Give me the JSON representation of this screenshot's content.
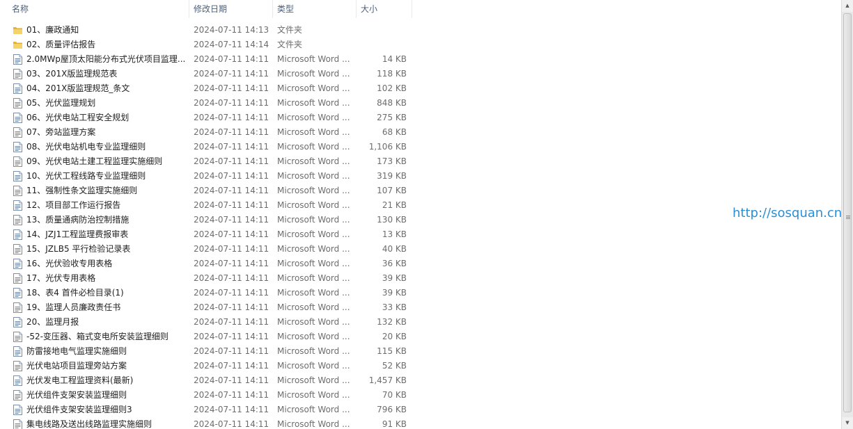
{
  "columns": {
    "name": "名称",
    "date": "修改日期",
    "type": "类型",
    "size": "大小"
  },
  "sort_indicator": "˄",
  "watermark": "http://sosquan.cn",
  "rows": [
    {
      "name": "01、廉政通知",
      "date": "2024-07-11 14:13",
      "type": "文件夹",
      "size": "",
      "icon": "folder"
    },
    {
      "name": "02、质量评估报告",
      "date": "2024-07-11 14:14",
      "type": "文件夹",
      "size": "",
      "icon": "folder"
    },
    {
      "name": "2.0MWp屋顶太阳能分布式光伏项目监理...",
      "date": "2024-07-11 14:11",
      "type": "Microsoft Word ...",
      "size": "14 KB",
      "icon": "doc"
    },
    {
      "name": "03、201X版监理规范表",
      "date": "2024-07-11 14:11",
      "type": "Microsoft Word ...",
      "size": "118 KB",
      "icon": "doc"
    },
    {
      "name": "04、201X版监理规范_条文",
      "date": "2024-07-11 14:11",
      "type": "Microsoft Word ...",
      "size": "102 KB",
      "icon": "doc"
    },
    {
      "name": "05、光伏监理规划",
      "date": "2024-07-11 14:11",
      "type": "Microsoft Word ...",
      "size": "848 KB",
      "icon": "doc"
    },
    {
      "name": "06、光伏电站工程安全规划",
      "date": "2024-07-11 14:11",
      "type": "Microsoft Word ...",
      "size": "275 KB",
      "icon": "doc"
    },
    {
      "name": "07、旁站监理方案",
      "date": "2024-07-11 14:11",
      "type": "Microsoft Word ...",
      "size": "68 KB",
      "icon": "doc"
    },
    {
      "name": "08、光伏电站机电专业监理细则",
      "date": "2024-07-11 14:11",
      "type": "Microsoft Word ...",
      "size": "1,106 KB",
      "icon": "doc"
    },
    {
      "name": "09、光伏电站土建工程监理实施细则",
      "date": "2024-07-11 14:11",
      "type": "Microsoft Word ...",
      "size": "173 KB",
      "icon": "doc"
    },
    {
      "name": "10、光伏工程线路专业监理细则",
      "date": "2024-07-11 14:11",
      "type": "Microsoft Word ...",
      "size": "319 KB",
      "icon": "doc"
    },
    {
      "name": "11、强制性条文监理实施细则",
      "date": "2024-07-11 14:11",
      "type": "Microsoft Word ...",
      "size": "107 KB",
      "icon": "doc"
    },
    {
      "name": "12、项目部工作运行报告",
      "date": "2024-07-11 14:11",
      "type": "Microsoft Word ...",
      "size": "21 KB",
      "icon": "doc"
    },
    {
      "name": "13、质量通病防治控制措施",
      "date": "2024-07-11 14:11",
      "type": "Microsoft Word ...",
      "size": "130 KB",
      "icon": "doc"
    },
    {
      "name": "14、JZJ1工程监理费报审表",
      "date": "2024-07-11 14:11",
      "type": "Microsoft Word ...",
      "size": "13 KB",
      "icon": "doc"
    },
    {
      "name": "15、JZLB5 平行检验记录表",
      "date": "2024-07-11 14:11",
      "type": "Microsoft Word ...",
      "size": "40 KB",
      "icon": "doc"
    },
    {
      "name": "16、光伏验收专用表格",
      "date": "2024-07-11 14:11",
      "type": "Microsoft Word ...",
      "size": "36 KB",
      "icon": "doc"
    },
    {
      "name": "17、光伏专用表格",
      "date": "2024-07-11 14:11",
      "type": "Microsoft Word ...",
      "size": "39 KB",
      "icon": "doc"
    },
    {
      "name": "18、表4 首件必检目录(1)",
      "date": "2024-07-11 14:11",
      "type": "Microsoft Word ...",
      "size": "39 KB",
      "icon": "doc"
    },
    {
      "name": "19、监理人员廉政责任书",
      "date": "2024-07-11 14:11",
      "type": "Microsoft Word ...",
      "size": "33 KB",
      "icon": "doc"
    },
    {
      "name": "20、监理月报",
      "date": "2024-07-11 14:11",
      "type": "Microsoft Word ...",
      "size": "132 KB",
      "icon": "doc"
    },
    {
      "name": "-52-变压器、箱式变电所安装监理细则",
      "date": "2024-07-11 14:11",
      "type": "Microsoft Word ...",
      "size": "20 KB",
      "icon": "doc"
    },
    {
      "name": "防雷接地电气监理实施细则",
      "date": "2024-07-11 14:11",
      "type": "Microsoft Word ...",
      "size": "115 KB",
      "icon": "doc"
    },
    {
      "name": "光伏电站项目监理旁站方案",
      "date": "2024-07-11 14:11",
      "type": "Microsoft Word ...",
      "size": "52 KB",
      "icon": "doc"
    },
    {
      "name": "光伏发电工程监理资料(最新)",
      "date": "2024-07-11 14:11",
      "type": "Microsoft Word ...",
      "size": "1,457 KB",
      "icon": "doc"
    },
    {
      "name": "光伏组件支架安装监理细则",
      "date": "2024-07-11 14:11",
      "type": "Microsoft Word ...",
      "size": "70 KB",
      "icon": "doc"
    },
    {
      "name": "光伏组件支架安装监理细则3",
      "date": "2024-07-11 14:11",
      "type": "Microsoft Word ...",
      "size": "796 KB",
      "icon": "doc"
    },
    {
      "name": "集电线路及送出线路监理实施细则",
      "date": "2024-07-11 14:11",
      "type": "Microsoft Word ...",
      "size": "91 KB",
      "icon": "doc"
    }
  ]
}
